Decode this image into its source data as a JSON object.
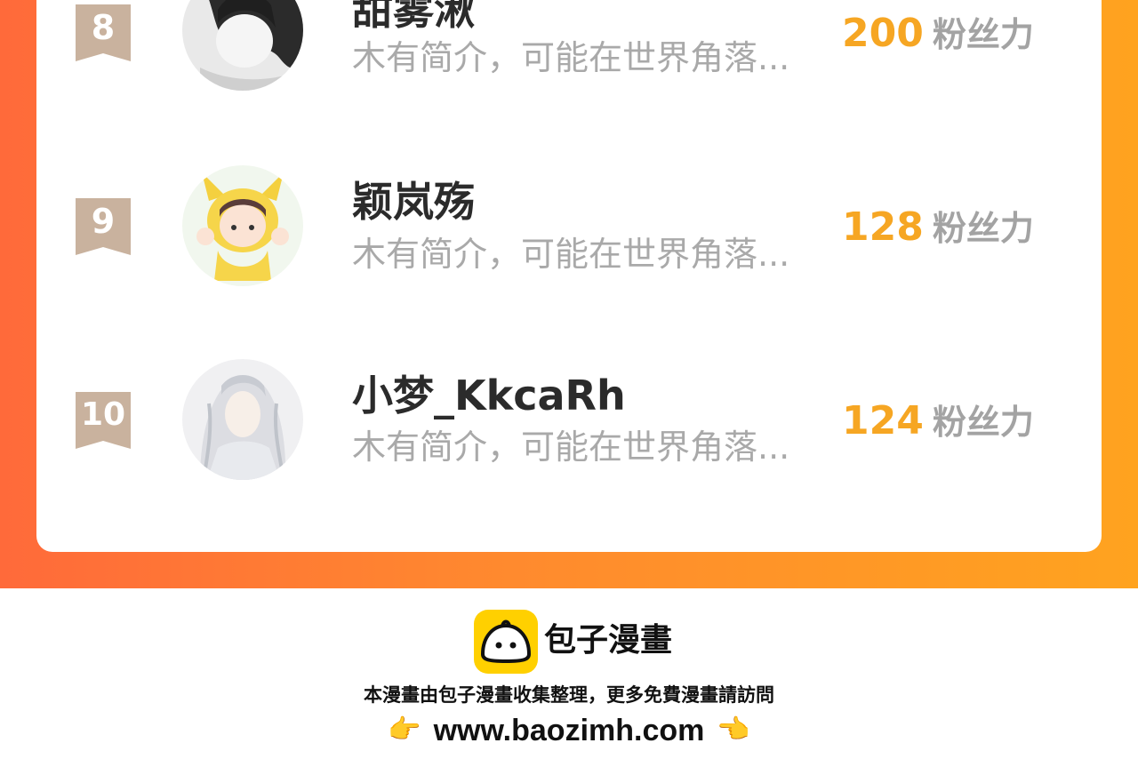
{
  "leaderboard": {
    "fans_label": "粉丝力",
    "accent_color": "#f6a623",
    "rows": [
      {
        "rank": "8",
        "name": "甜雾湫",
        "bio": "木有简介，可能在世界角落...",
        "fans": "200"
      },
      {
        "rank": "9",
        "name": "颖岚殇",
        "bio": "木有简介，可能在世界角落...",
        "fans": "128"
      },
      {
        "rank": "10",
        "name": "小梦_KkcaRh",
        "bio": "木有简介，可能在世界角落...",
        "fans": "124"
      }
    ]
  },
  "footer": {
    "brand": "包子漫畫",
    "logo_icon": "bun-icon",
    "notice": "本漫畫由包子漫畫收集整理，更多免費漫畫請訪問",
    "url": "www.baozimh.com",
    "left_hand": "👉",
    "right_hand": "👈"
  }
}
